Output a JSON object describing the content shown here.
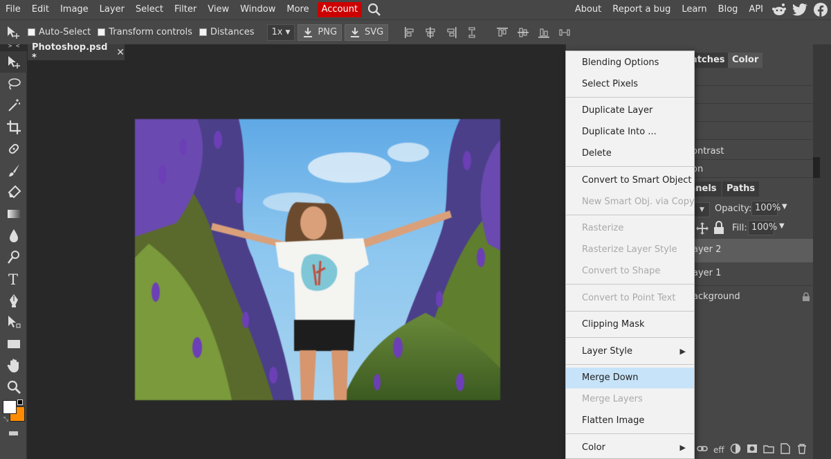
{
  "menubar": {
    "items": [
      "File",
      "Edit",
      "Image",
      "Layer",
      "Select",
      "Filter",
      "View",
      "Window",
      "More"
    ],
    "account": "Account",
    "right_links": [
      "About",
      "Report a bug",
      "Learn",
      "Blog",
      "API"
    ],
    "accent_color": "#cc0000"
  },
  "options": {
    "auto_select": "Auto-Select",
    "transform_controls": "Transform controls",
    "distances": "Distances",
    "zoom": "1x",
    "export_png": "PNG",
    "export_svg": "SVG"
  },
  "collapse": {
    "left": "> <",
    "mid": "< >",
    "right": "> <"
  },
  "document": {
    "tab_title": "Photoshop.psd *",
    "close": "✕"
  },
  "right_panel": {
    "tabs_top": [
      "atches",
      "Color"
    ],
    "adjust_rows": [
      "ontrast",
      "on"
    ],
    "tabs_layers": [
      "nnels",
      "Paths"
    ],
    "opacity_label": "Opacity:",
    "opacity_value": "100%",
    "fill_label": "Fill:",
    "fill_value": "100%",
    "layers": [
      "ayer 2",
      "ayer 1",
      "ackground"
    ],
    "footer_eff": "eff"
  },
  "context_menu": {
    "items": [
      {
        "label": "Blending Options",
        "state": "enabled"
      },
      {
        "label": "Select Pixels",
        "state": "enabled"
      },
      {
        "label": "Duplicate Layer",
        "state": "enabled"
      },
      {
        "label": "Duplicate Into ...",
        "state": "enabled"
      },
      {
        "label": "Delete",
        "state": "enabled"
      },
      {
        "label": "Convert to Smart Object",
        "state": "enabled"
      },
      {
        "label": "New Smart Obj. via Copy",
        "state": "disabled"
      },
      {
        "label": "Rasterize",
        "state": "disabled"
      },
      {
        "label": "Rasterize Layer Style",
        "state": "disabled"
      },
      {
        "label": "Convert to Shape",
        "state": "disabled"
      },
      {
        "label": "Convert to Point Text",
        "state": "disabled"
      },
      {
        "label": "Clipping Mask",
        "state": "enabled"
      },
      {
        "label": "Layer Style",
        "state": "enabled",
        "submenu": true
      },
      {
        "label": "Merge Down",
        "state": "highlighted"
      },
      {
        "label": "Merge Layers",
        "state": "disabled"
      },
      {
        "label": "Flatten Image",
        "state": "enabled"
      },
      {
        "label": "Color",
        "state": "enabled",
        "submenu": true
      }
    ],
    "highlight_color": "#c6e3f9"
  },
  "colors": {
    "foreground": "#ffffff",
    "background": "#ff8c00"
  },
  "icons": [
    "search-icon",
    "reddit-icon",
    "twitter-icon",
    "facebook-icon",
    "move-tool-icon",
    "lasso-icon",
    "magic-wand-icon",
    "crop-icon",
    "healing-icon",
    "brush-icon",
    "eraser-icon",
    "gradient-icon",
    "blur-icon",
    "dodge-icon",
    "type-icon",
    "pen-icon",
    "path-select-icon",
    "rectangle-icon",
    "hand-icon",
    "zoom-icon",
    "lock-icon"
  ]
}
